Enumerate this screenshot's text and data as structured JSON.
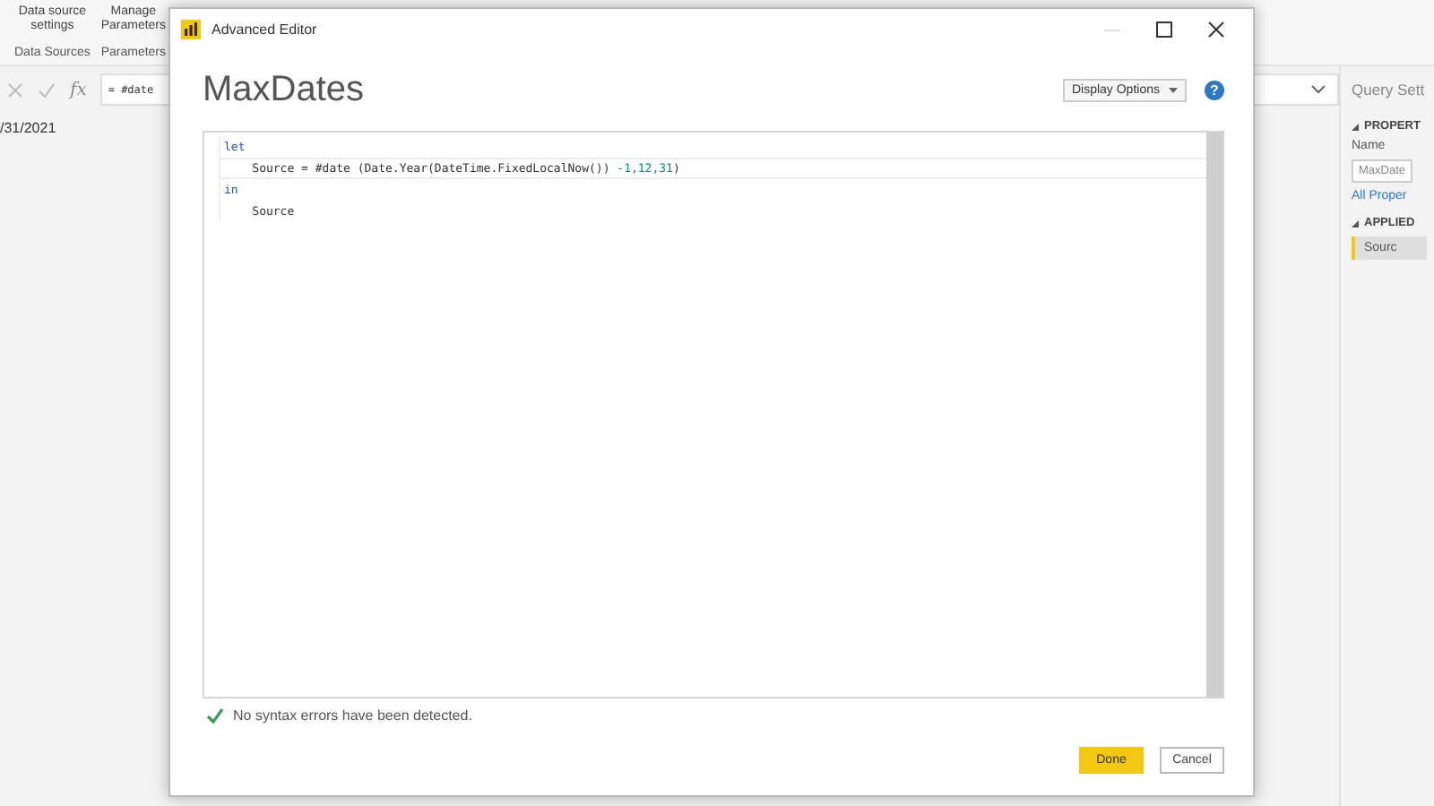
{
  "ribbon": {
    "buttons": [
      {
        "label": "Data source settings"
      },
      {
        "label": "Manage Parameters"
      }
    ],
    "groups": [
      "Data Sources",
      "Parameters"
    ]
  },
  "formula_bar": {
    "fx": "fx",
    "value": "= #date"
  },
  "preview": {
    "cell": "/31/2021"
  },
  "query_settings": {
    "title": "Query Sett",
    "properties_heading": "PROPERT",
    "name_label": "Name",
    "name_value": "MaxDate",
    "all_properties_link": "All Proper",
    "applied_heading": "APPLIED",
    "steps": [
      {
        "label": "Sourc",
        "selected": true
      }
    ]
  },
  "dialog": {
    "title": "Advanced Editor",
    "heading": "MaxDates",
    "display_options": "Display Options",
    "help": "?",
    "code_lines": [
      {
        "current": false,
        "tokens": [
          {
            "text": "let",
            "kind": "keyword"
          }
        ]
      },
      {
        "current": true,
        "tokens": [
          {
            "text": "    Source = #date (Date.Year(DateTime.FixedLocalNow()) ",
            "kind": "plain"
          },
          {
            "text": "-1,12,31",
            "kind": "number"
          },
          {
            "text": ")",
            "kind": "plain"
          }
        ]
      },
      {
        "current": false,
        "tokens": [
          {
            "text": "in",
            "kind": "keyword"
          }
        ]
      },
      {
        "current": false,
        "tokens": [
          {
            "text": "    Source",
            "kind": "plain"
          }
        ]
      }
    ],
    "status": "No syntax errors have been detected.",
    "buttons": [
      {
        "label": "Done",
        "kind": "primary"
      },
      {
        "label": "Cancel",
        "kind": "secondary"
      }
    ]
  }
}
